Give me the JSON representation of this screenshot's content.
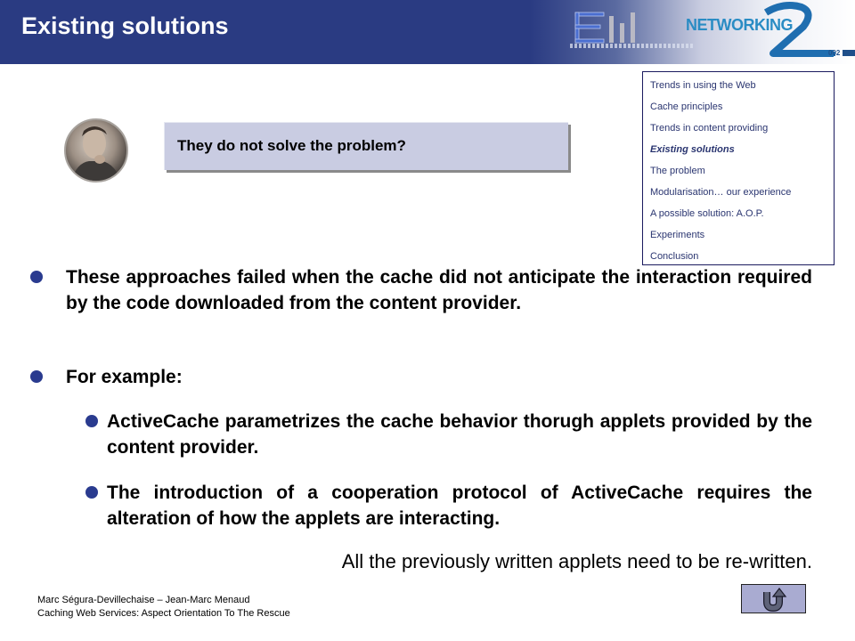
{
  "header": {
    "title": "Existing solutions",
    "logo_left": "em-logo",
    "logo_right_text": "NETWORKING",
    "logo_right_numeral": "2",
    "logo_right_year": "002"
  },
  "navigation": {
    "items": [
      {
        "label": "Trends in using the Web",
        "current": false
      },
      {
        "label": "Cache principles",
        "current": false
      },
      {
        "label": "Trends in content providing",
        "current": false
      },
      {
        "label": "Existing solutions",
        "current": true
      },
      {
        "label": "The problem",
        "current": false
      },
      {
        "label": "Modularisation… our experience",
        "current": false
      },
      {
        "label": "A possible solution: A.O.P.",
        "current": false
      },
      {
        "label": "Experiments",
        "current": false
      },
      {
        "label": "Conclusion",
        "current": false
      }
    ]
  },
  "callout": {
    "text": "They do not solve the problem?",
    "avatar_icon": "thinking-man-portrait"
  },
  "body": {
    "bullets": [
      {
        "level": 1,
        "text": "These approaches failed when the cache did not anticipate the interaction required by the code downloaded from the content provider."
      },
      {
        "level": 1,
        "text": "For example:"
      },
      {
        "level": 2,
        "text": "ActiveCache parametrizes the cache behavior thorugh applets provided by the content provider."
      },
      {
        "level": 2,
        "text": "The introduction of a cooperation protocol of ActiveCache requires the alteration of how the applets are interacting."
      }
    ],
    "conclusion": "All the previously written applets need to be re-written."
  },
  "footer": {
    "authors": "Marc Ségura-Devillechaise – Jean-Marc Menaud",
    "talk_title": "Caching Web Services: Aspect Orientation To The Rescue",
    "home_icon": "u-turn-arrow-icon"
  },
  "colors": {
    "header_blue": "#2a3b82",
    "bullet_blue": "#2a3b8f",
    "callout_bg": "#c9cce2",
    "nav_text": "#2a3570",
    "home_button_bg": "#a9abd1"
  }
}
